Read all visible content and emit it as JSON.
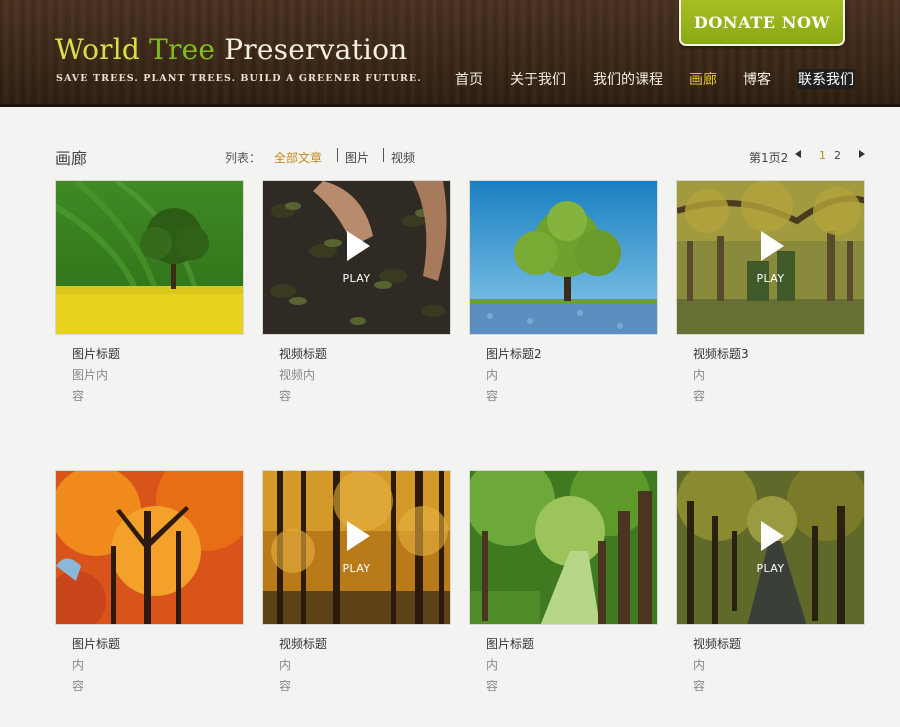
{
  "brand": {
    "logo_word1": "World",
    "logo_word2": "Tree",
    "logo_word3": "Preservation",
    "tagline": "SAVE TREES. PLANT TREES. BUILD A GREENER FUTURE.",
    "donate_label": "DONATE NOW"
  },
  "nav": {
    "items": [
      {
        "label": "首页"
      },
      {
        "label": "关于我们"
      },
      {
        "label": "我们的课程"
      },
      {
        "label": "画廊"
      },
      {
        "label": "博客"
      },
      {
        "label": "联系我们"
      }
    ],
    "active": "画廊"
  },
  "gallery": {
    "title": "画廊",
    "filter_label": "列表：",
    "filters": [
      {
        "label": "全部文章"
      },
      {
        "label": "图片"
      },
      {
        "label": "视频"
      }
    ],
    "active_filter": "全部文章",
    "page_info": "第1页2",
    "pages": [
      "1",
      "2"
    ],
    "current_page": "1"
  },
  "play_label": "PLAY",
  "cards": [
    {
      "title": "图片标题",
      "desc_line1": "图片内",
      "desc_line2": "容",
      "video": false,
      "scene": "field"
    },
    {
      "title": "视频标题",
      "desc_line1": "视频内",
      "desc_line2": "容",
      "video": true,
      "scene": "soil"
    },
    {
      "title": "图片标题2",
      "desc_line1": "内",
      "desc_line2": "容",
      "video": false,
      "scene": "sky"
    },
    {
      "title": "视频标题3",
      "desc_line1": "内",
      "desc_line2": "容",
      "video": true,
      "scene": "park"
    },
    {
      "title": "图片标题",
      "desc_line1": "内",
      "desc_line2": "容",
      "video": false,
      "scene": "autumn"
    },
    {
      "title": "视频标题",
      "desc_line1": "内",
      "desc_line2": "容",
      "video": true,
      "scene": "forest"
    },
    {
      "title": "图片标题",
      "desc_line1": "内",
      "desc_line2": "容",
      "video": false,
      "scene": "path"
    },
    {
      "title": "视频标题",
      "desc_line1": "内",
      "desc_line2": "容",
      "video": true,
      "scene": "road"
    }
  ],
  "colors": {
    "header_wood": "#3c2817",
    "accent_green": "#8aa815",
    "active_gold": "#c78a1c",
    "nav_active": "#e8c43a"
  }
}
